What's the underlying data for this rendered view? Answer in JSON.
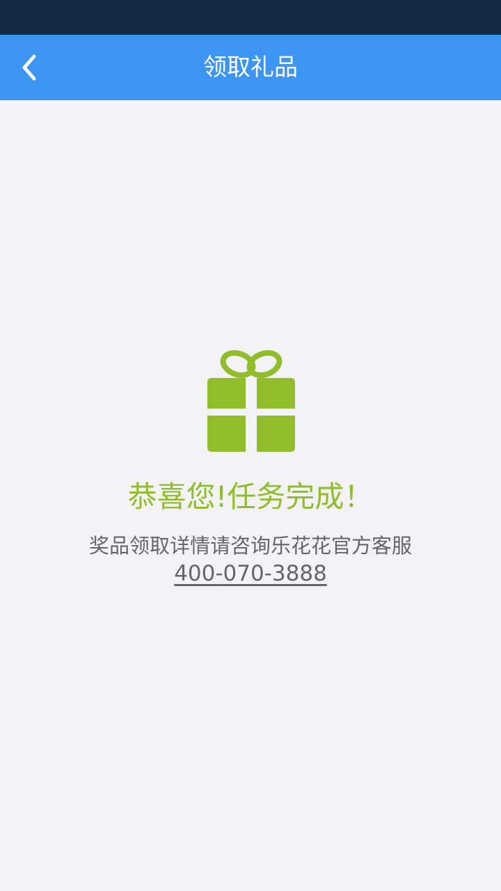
{
  "header": {
    "title": "领取礼品",
    "back_icon": "chevron-left-icon"
  },
  "main": {
    "icon": "gift-icon",
    "success_text": "恭喜您!任务完成！",
    "info_text": "奖品领取详情请咨询乐花花官方客服",
    "phone": "400-070-3888"
  },
  "colors": {
    "status_bar": "#132b46",
    "nav_bar": "#3b95f1",
    "background": "#f2f2f7",
    "accent_green": "#92bd2b",
    "text_gray": "#666666"
  }
}
